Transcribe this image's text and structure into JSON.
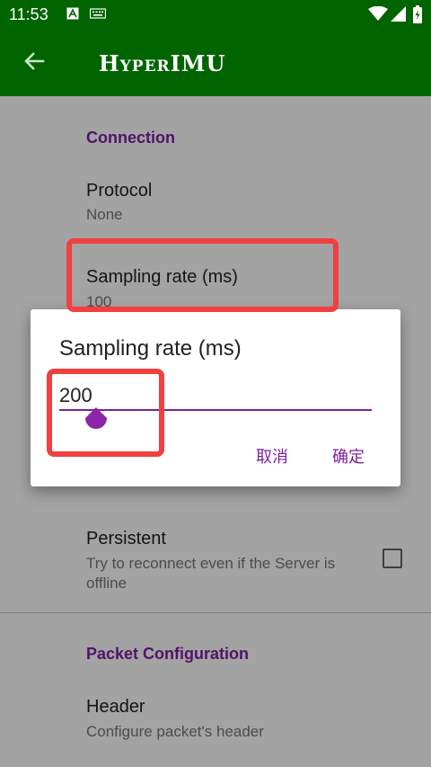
{
  "status_bar": {
    "time": "11:53"
  },
  "app_bar": {
    "title": "HyperIMU"
  },
  "settings": {
    "connection_category": "Connection",
    "protocol": {
      "title": "Protocol",
      "summary": "None"
    },
    "sampling_rate": {
      "title": "Sampling rate (ms)",
      "summary": "100"
    },
    "persistent": {
      "title": "Persistent",
      "summary": "Try to reconnect even if the Server is offline",
      "checked": false
    },
    "packet_category": "Packet Configuration",
    "header": {
      "title": "Header",
      "summary": "Configure packet's header"
    }
  },
  "dialog": {
    "title": "Sampling rate (ms)",
    "input_value": "200",
    "cancel_label": "取消",
    "ok_label": "确定"
  },
  "colors": {
    "app_bar": "#006400",
    "accent": "#7b1fa2",
    "highlight": "#f04040"
  }
}
